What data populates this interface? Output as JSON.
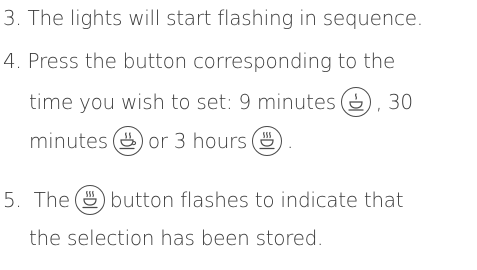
{
  "steps": [
    {
      "number": "3.",
      "line1": "The lights will start flashing in sequence."
    },
    {
      "number": "4.",
      "line1": "Press the button corresponding to the",
      "line2_text": "time you wish to set: 9 minutes",
      "line2_after": ", 30",
      "line3_before": "minutes",
      "line3_mid": "or 3 hours",
      "line3_after": "."
    },
    {
      "number": "5.",
      "line1_after": "button flashes to indicate that",
      "line2": "the selection has been stored."
    }
  ],
  "icons": {
    "nine_minutes": "cup-single-steam-icon",
    "thirty_minutes": "cup-double-steam-icon",
    "three_hours": "cup-triple-steam-icon"
  }
}
